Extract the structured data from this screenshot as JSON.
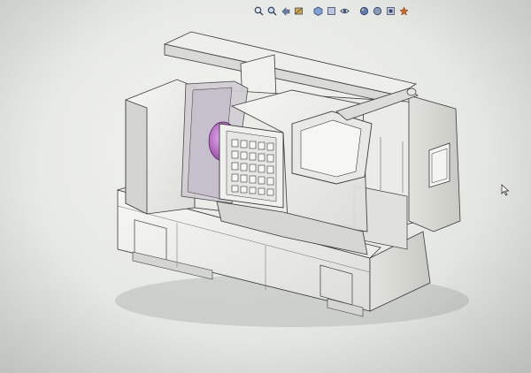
{
  "app": {
    "name": "CAD 3D viewport"
  },
  "toolbar": {
    "icons": [
      "zoom-to-fit-icon",
      "zoom-to-area-icon",
      "previous-view-icon",
      "section-view-icon",
      "view-orientation-icon",
      "display-style-icon",
      "hide-show-items-icon",
      "edit-appearance-icon",
      "apply-scene-icon",
      "view-settings-icon"
    ]
  },
  "model": {
    "description_color_body": "#f2f2ef",
    "line_color": "#3a3a3a",
    "chuck_color": "#b05fc0"
  },
  "colors": {
    "background": "#e6e8e4",
    "toolbar_icon": "#3b4a6b"
  }
}
